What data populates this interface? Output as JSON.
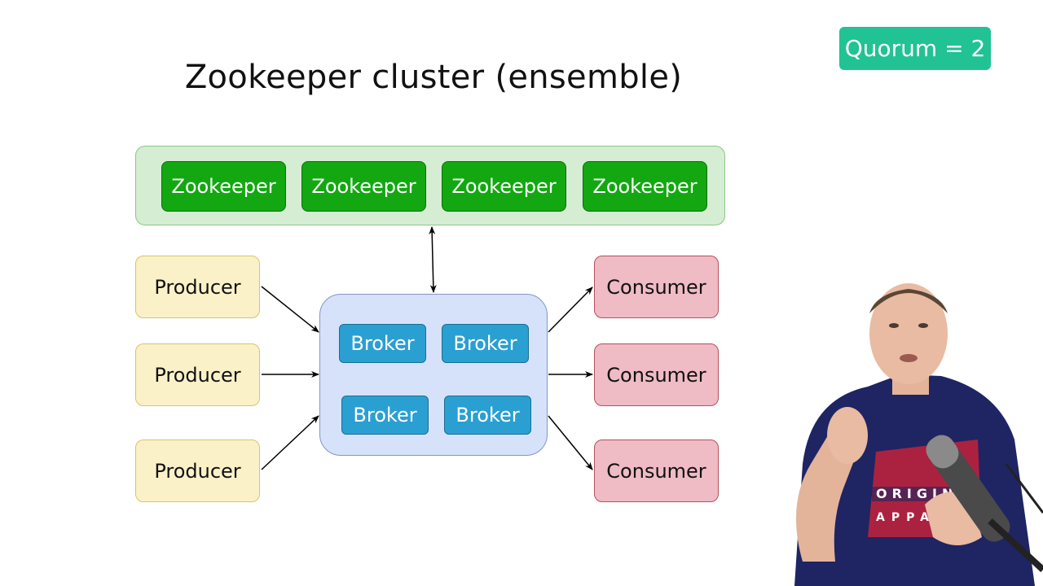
{
  "slide": {
    "title": "Zookeeper cluster (ensemble)",
    "quorum_badge": "Quorum = 2",
    "colors": {
      "quorum_badge": "#21c294",
      "zookeeper_cluster_bg": "#d5edd3",
      "zookeeper_node": "#13a811",
      "producer": "#fbf1c8",
      "consumer": "#efbbc5",
      "broker_cluster_bg": "#d6e2f9",
      "broker": "#2a9fd2"
    }
  },
  "zookeeper_cluster": {
    "nodes": [
      "Zookeeper",
      "Zookeeper",
      "Zookeeper",
      "Zookeeper"
    ]
  },
  "producers": [
    "Producer",
    "Producer",
    "Producer"
  ],
  "broker_cluster": {
    "brokers": [
      "Broker",
      "Broker",
      "Broker",
      "Broker"
    ]
  },
  "consumers": [
    "Consumer",
    "Consumer",
    "Consumer"
  ],
  "connections": [
    {
      "from": "zookeeper-cluster",
      "to": "broker-cluster",
      "direction": "bidirectional"
    },
    {
      "from": "producer-1",
      "to": "broker-cluster"
    },
    {
      "from": "producer-2",
      "to": "broker-cluster"
    },
    {
      "from": "producer-3",
      "to": "broker-cluster"
    },
    {
      "from": "broker-cluster",
      "to": "consumer-1"
    },
    {
      "from": "broker-cluster",
      "to": "consumer-2"
    },
    {
      "from": "broker-cluster",
      "to": "consumer-3"
    }
  ],
  "presenter": {
    "shirt_text_line1": "ORIGINAL",
    "shirt_text_line2": "APPA"
  }
}
